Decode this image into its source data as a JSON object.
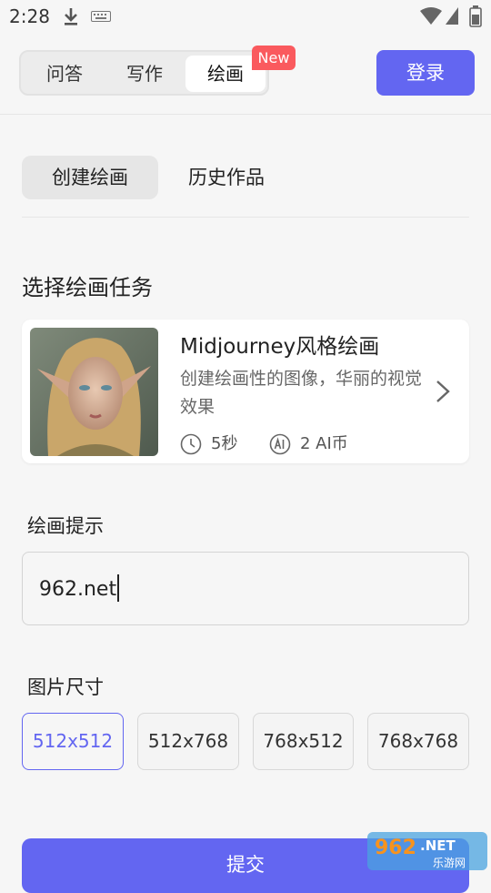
{
  "status_bar": {
    "time": "2:28"
  },
  "header": {
    "tabs": [
      "问答",
      "写作",
      "绘画"
    ],
    "active_tab": "绘画",
    "new_badge": "New",
    "login_label": "登录"
  },
  "sub_tabs": {
    "create": "创建绘画",
    "history": "历史作品"
  },
  "task_section": {
    "title": "选择绘画任务",
    "card": {
      "title": "Midjourney风格绘画",
      "description": "创建绘画性的图像，华丽的视觉效果",
      "time": "5秒",
      "cost": "2 AI币"
    }
  },
  "prompt": {
    "label": "绘画提示",
    "value": "962.net"
  },
  "image_size": {
    "label": "图片尺寸",
    "options": [
      "512x512",
      "512x768",
      "768x512",
      "768x768"
    ],
    "selected": "512x512"
  },
  "submit_label": "提交",
  "accent_color": "#6366f1",
  "badge_color": "#fa5a5e"
}
